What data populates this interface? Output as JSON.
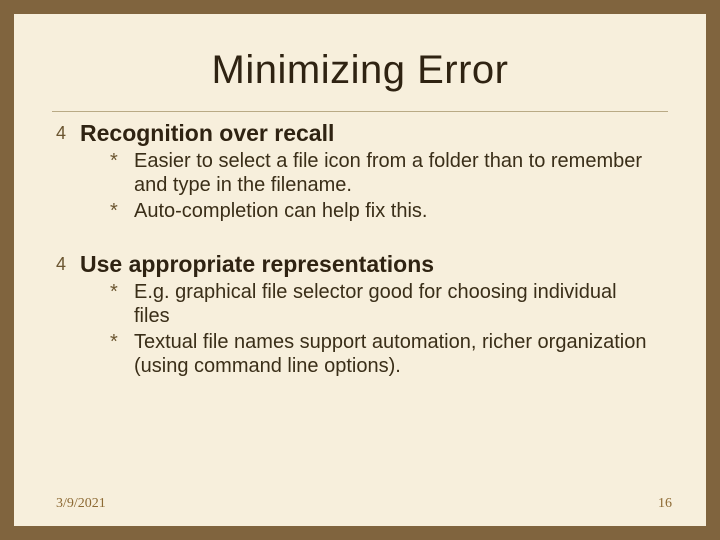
{
  "slide": {
    "title": "Minimizing Error",
    "sections": [
      {
        "heading": "Recognition over recall",
        "items": [
          "Easier to select a file icon from a folder than to remember and type in the filename.",
          "Auto-completion can help fix this."
        ]
      },
      {
        "heading": "Use appropriate representations",
        "items": [
          "E.g. graphical file selector good for choosing individual files",
          "Textual file names support automation, richer organization (using command line options)."
        ]
      }
    ],
    "footer": {
      "date": "3/9/2021",
      "page": "16"
    }
  }
}
